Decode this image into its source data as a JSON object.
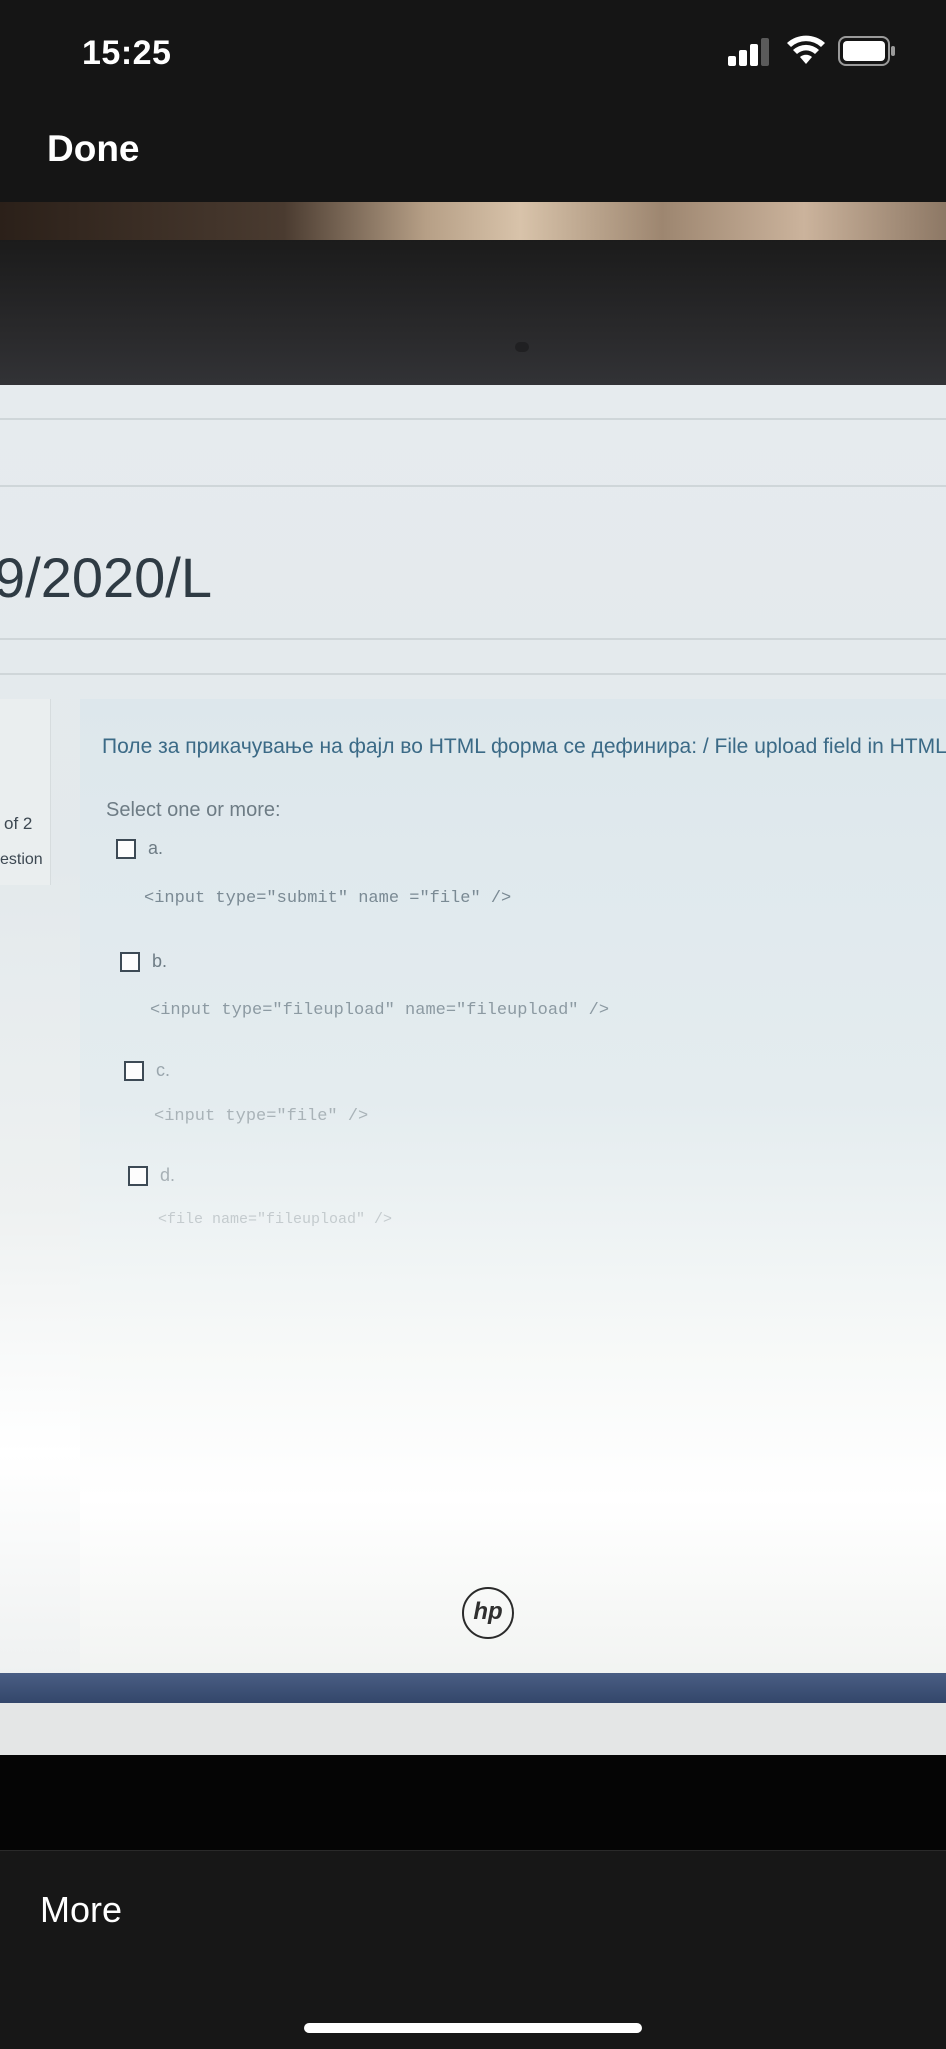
{
  "status_bar": {
    "time": "15:25",
    "icons": [
      "signal-icon",
      "wifi-icon",
      "battery-icon"
    ]
  },
  "nav": {
    "done_label": "Done"
  },
  "photo": {
    "screen": {
      "course_title": "9/2020/L",
      "sidebar": {
        "page_text": "of 2",
        "question_text": "estion"
      },
      "question": {
        "text": "Поле за прикачување на фајл во HTML форма се дефинира: / File upload field in HTML",
        "select_hint": "Select one or more:",
        "options": [
          {
            "letter": "a.",
            "code": "<input type=\"submit\" name =\"file\" />"
          },
          {
            "letter": "b.",
            "code": "<input type=\"fileupload\" name=\"fileupload\" />"
          },
          {
            "letter": "c.",
            "code": "<input type=\"file\" />"
          },
          {
            "letter": "d.",
            "code": "<file name=\"fileupload\" />"
          }
        ]
      }
    },
    "laptop_logo": "hp"
  },
  "bottom_bar": {
    "more_label": "More"
  },
  "colors": {
    "ios_bar": "#151515",
    "question_text": "#3b6a86",
    "taskbar": "#3f5278"
  }
}
